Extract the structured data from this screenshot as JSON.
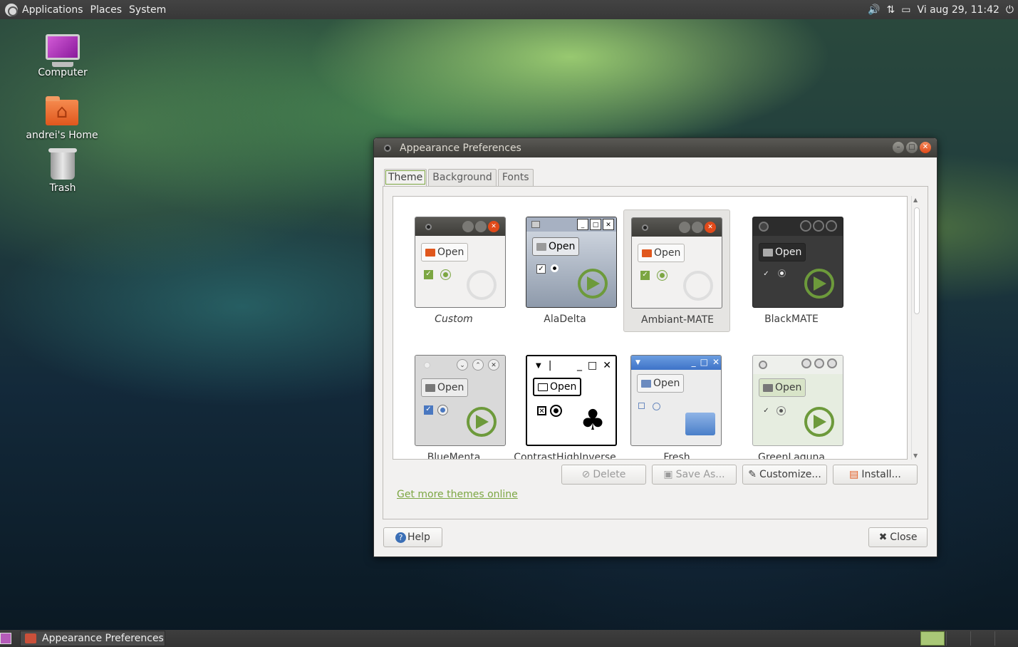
{
  "top_panel": {
    "menus": [
      "Applications",
      "Places",
      "System"
    ],
    "clock": "Vi aug 29, 11:42",
    "tray": [
      "volume-icon",
      "network-icon",
      "battery-icon",
      "power-icon"
    ]
  },
  "desktop_icons": [
    {
      "label": "Computer",
      "icon": "computer-icon"
    },
    {
      "label": "andrei's Home",
      "icon": "home-folder-icon"
    },
    {
      "label": "Trash",
      "icon": "trash-icon"
    }
  ],
  "window": {
    "title": "Appearance Preferences",
    "tabs": [
      "Theme",
      "Background",
      "Fonts"
    ],
    "active_tab": "Theme",
    "themes": [
      {
        "name": "Custom",
        "italic": true,
        "open": "Open"
      },
      {
        "name": "AlaDelta",
        "open": "Open"
      },
      {
        "name": "Ambiant-MATE",
        "selected": true,
        "open": "Open"
      },
      {
        "name": "BlackMATE",
        "open": "Open"
      },
      {
        "name": "BlueMenta",
        "open": "Open"
      },
      {
        "name": "ContrastHighInverse",
        "open": "Open"
      },
      {
        "name": "Fresh",
        "open": "Open"
      },
      {
        "name": "GreenLaguna",
        "open": "Open"
      }
    ],
    "actions": {
      "delete": "Delete",
      "save_as": "Save As...",
      "customize": "Customize...",
      "install": "Install..."
    },
    "more_link": "Get more themes online",
    "help": "Help",
    "close": "Close"
  },
  "bottom_panel": {
    "task": "Appearance Preferences"
  },
  "colors": {
    "accent": "#7ca642",
    "titlebar": "#3d3c38",
    "close_button": "#e14a1a"
  }
}
